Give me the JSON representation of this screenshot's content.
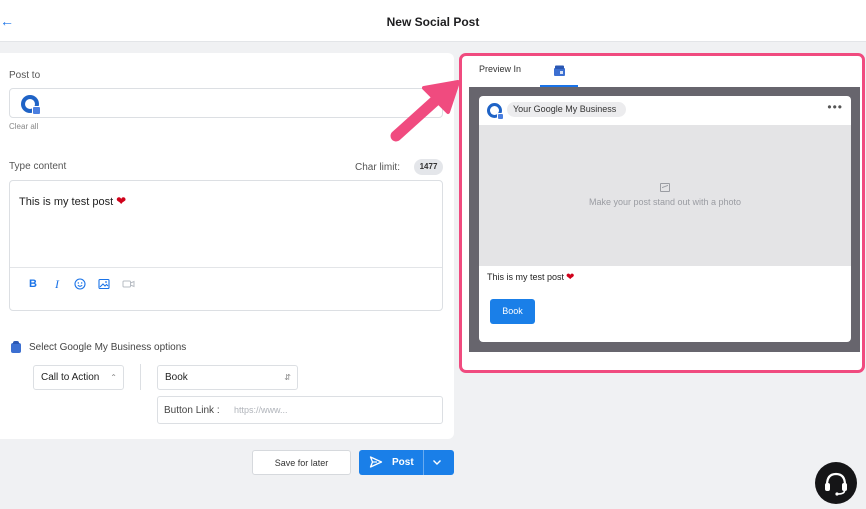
{
  "header": {
    "title": "New Social Post",
    "back_icon": "arrow-left-icon"
  },
  "compose": {
    "post_to_label": "Post to",
    "clear_all": "Clear all",
    "type_content_label": "Type content",
    "char_limit_label": "Char limit:",
    "char_limit_value": "1477",
    "content_text": "This is my test post",
    "heart_emoji": "❤",
    "toolbar_icons": [
      "bold-icon",
      "italic-icon",
      "emoji-icon",
      "image-icon",
      "video-icon"
    ]
  },
  "gmb_options": {
    "label": "Select Google My Business options",
    "action_select": "Call to Action",
    "button_select": "Book",
    "button_link_label": "Button Link :",
    "button_link_placeholder": "https://www..."
  },
  "actions": {
    "save_label": "Save for later",
    "post_label": "Post"
  },
  "preview": {
    "tab_label": "Preview In",
    "account_name": "Your Google My Business",
    "photo_placeholder": "Make your post stand out with a photo",
    "post_text": "This is my test post",
    "cta_label": "Book"
  },
  "colors": {
    "accent": "#1a7fe8",
    "highlight": "#f04b7f",
    "preview_bg": "#67656d"
  }
}
